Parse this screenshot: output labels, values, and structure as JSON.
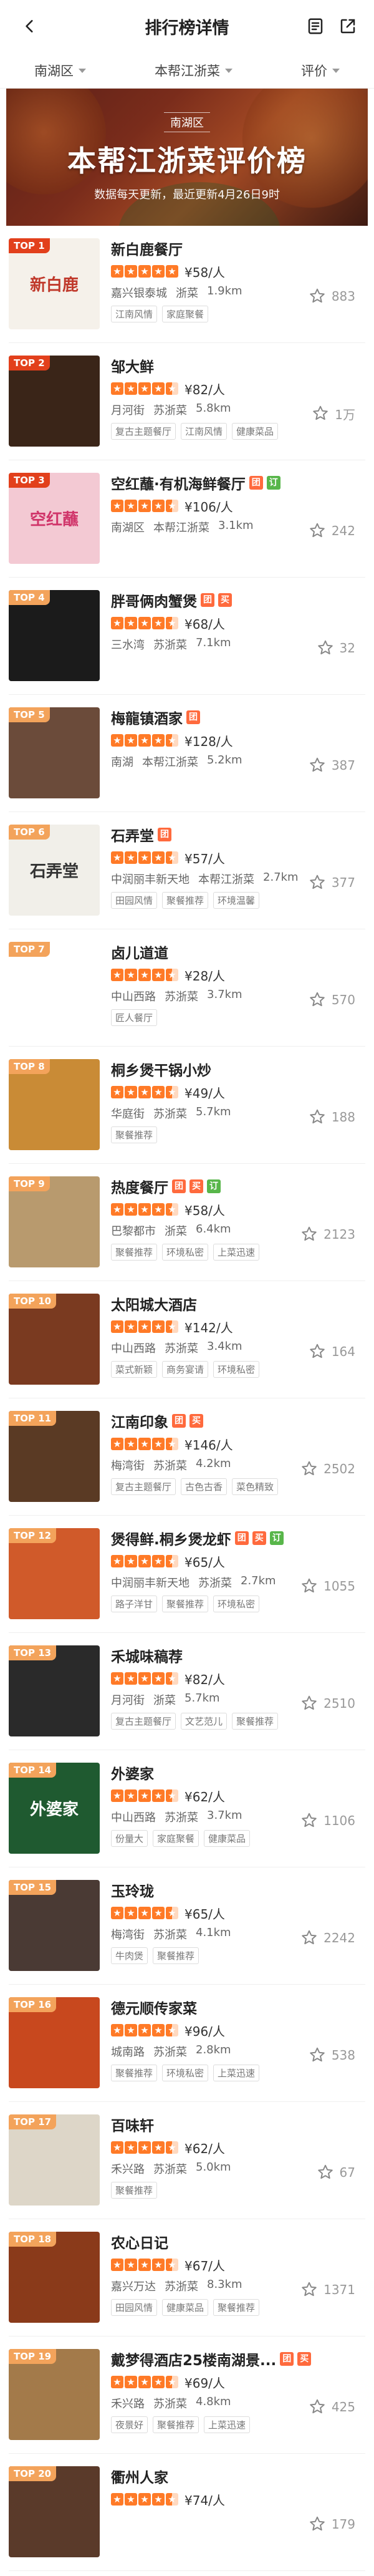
{
  "header": {
    "title": "排行榜详情"
  },
  "filters": [
    {
      "label": "南湖区"
    },
    {
      "label": "本帮江浙菜"
    },
    {
      "label": "评价"
    }
  ],
  "banner": {
    "district": "南湖区",
    "headline": "本帮江浙菜评价榜",
    "sub": "数据每天更新，最近更新4月26日9时"
  },
  "items": [
    {
      "rank": "TOP 1",
      "name": "新白鹿餐厅",
      "tags": [],
      "stars": 5,
      "price": "¥58/人",
      "area": "嘉兴银泰城",
      "cuisine": "浙菜",
      "dist": "1.9km",
      "chips": [
        "江南风情",
        "家庭聚餐"
      ],
      "fav": "883",
      "thumb": "#f5f1ea",
      "thumb_text": "新白鹿",
      "thumb_color": "#c0392b"
    },
    {
      "rank": "TOP 2",
      "name": "邹大鲜",
      "tags": [],
      "stars": 4.5,
      "price": "¥82/人",
      "area": "月河街",
      "cuisine": "苏浙菜",
      "dist": "5.8km",
      "chips": [
        "复古主题餐厅",
        "江南风情",
        "健康菜品"
      ],
      "fav": "1万",
      "thumb": "#3a2518",
      "thumb_text": "",
      "thumb_color": "#fff"
    },
    {
      "rank": "TOP 3",
      "name": "空红蘸·有机海鲜餐厅",
      "tags": [
        "团",
        "订"
      ],
      "stars": 4.5,
      "price": "¥106/人",
      "area": "南湖区",
      "cuisine": "本帮江浙菜",
      "dist": "3.1km",
      "chips": [],
      "fav": "242",
      "thumb": "#f3c9d3",
      "thumb_text": "空红蘸",
      "thumb_color": "#d0356a"
    },
    {
      "rank": "TOP 4",
      "name": "胖哥俩肉蟹煲",
      "tags": [
        "团",
        "买"
      ],
      "stars": 4.5,
      "price": "¥68/人",
      "area": "三水湾",
      "cuisine": "苏浙菜",
      "dist": "7.1km",
      "chips": [],
      "fav": "32",
      "thumb": "#1b1b1b",
      "thumb_text": "",
      "thumb_color": "#fff"
    },
    {
      "rank": "TOP 5",
      "name": "梅龍镇酒家",
      "tags": [
        "团"
      ],
      "stars": 4.5,
      "price": "¥128/人",
      "area": "南湖",
      "cuisine": "本帮江浙菜",
      "dist": "5.2km",
      "chips": [],
      "fav": "387",
      "thumb": "#6b4b3a",
      "thumb_text": "",
      "thumb_color": "#fff"
    },
    {
      "rank": "TOP 6",
      "name": "石弄堂",
      "tags": [
        "团"
      ],
      "stars": 4.5,
      "price": "¥57/人",
      "area": "中润丽丰新天地",
      "cuisine": "本帮江浙菜",
      "dist": "2.7km",
      "chips": [
        "田园风情",
        "聚餐推荐",
        "环境温馨"
      ],
      "fav": "377",
      "thumb": "#f1efe9",
      "thumb_text": "石弄堂",
      "thumb_color": "#333"
    },
    {
      "rank": "TOP 7",
      "name": "卤儿道道",
      "tags": [],
      "stars": 4.5,
      "price": "¥28/人",
      "area": "中山西路",
      "cuisine": "苏浙菜",
      "dist": "3.7km",
      "chips": [
        "匠人餐厅"
      ],
      "fav": "570",
      "thumb": "#ffffff",
      "thumb_text": "",
      "thumb_color": "#1c4c74"
    },
    {
      "rank": "TOP 8",
      "name": "桐乡煲干锅小炒",
      "tags": [],
      "stars": 4.5,
      "price": "¥49/人",
      "area": "华庭街",
      "cuisine": "苏浙菜",
      "dist": "5.7km",
      "chips": [
        "聚餐推荐"
      ],
      "fav": "188",
      "thumb": "#c98b36",
      "thumb_text": "",
      "thumb_color": "#fff"
    },
    {
      "rank": "TOP 9",
      "name": "热度餐厅",
      "tags": [
        "团",
        "买",
        "订"
      ],
      "stars": 4.5,
      "price": "¥58/人",
      "area": "巴黎都市",
      "cuisine": "浙菜",
      "dist": "6.4km",
      "chips": [
        "聚餐推荐",
        "环境私密",
        "上菜迅速"
      ],
      "fav": "2123",
      "thumb": "#b89a6e",
      "thumb_text": "",
      "thumb_color": "#fff"
    },
    {
      "rank": "TOP 10",
      "name": "太阳城大酒店",
      "tags": [],
      "stars": 4.5,
      "price": "¥142/人",
      "area": "中山西路",
      "cuisine": "苏浙菜",
      "dist": "3.4km",
      "chips": [
        "菜式新颖",
        "商务宴请",
        "环境私密"
      ],
      "fav": "164",
      "thumb": "#7a3a20",
      "thumb_text": "",
      "thumb_color": "#fff"
    },
    {
      "rank": "TOP 11",
      "name": "江南印象",
      "tags": [
        "团",
        "买"
      ],
      "stars": 4.5,
      "price": "¥146/人",
      "area": "梅湾街",
      "cuisine": "苏浙菜",
      "dist": "4.2km",
      "chips": [
        "复古主题餐厅",
        "古色古香",
        "菜色精致"
      ],
      "fav": "2502",
      "thumb": "#5a3a24",
      "thumb_text": "",
      "thumb_color": "#fff"
    },
    {
      "rank": "TOP 12",
      "name": "煲得鲜.桐乡煲龙虾",
      "tags": [
        "团",
        "买",
        "订"
      ],
      "stars": 4.5,
      "price": "¥65/人",
      "area": "中润丽丰新天地",
      "cuisine": "苏浙菜",
      "dist": "2.7km",
      "chips": [
        "路子洋甘",
        "聚餐推荐",
        "环境私密"
      ],
      "fav": "1055",
      "thumb": "#d05a2a",
      "thumb_text": "",
      "thumb_color": "#fff"
    },
    {
      "rank": "TOP 13",
      "name": "禾城味稿荐",
      "tags": [],
      "stars": 4.5,
      "price": "¥82/人",
      "area": "月河街",
      "cuisine": "浙菜",
      "dist": "5.7km",
      "chips": [
        "复古主题餐厅",
        "文艺范儿",
        "聚餐推荐"
      ],
      "fav": "2510",
      "thumb": "#2a2a2a",
      "thumb_text": "",
      "thumb_color": "#fff"
    },
    {
      "rank": "TOP 14",
      "name": "外婆家",
      "tags": [],
      "stars": 4.5,
      "price": "¥62/人",
      "area": "中山西路",
      "cuisine": "苏浙菜",
      "dist": "3.7km",
      "chips": [
        "份量大",
        "家庭聚餐",
        "健康菜品"
      ],
      "fav": "1106",
      "thumb": "#1f5a30",
      "thumb_text": "外婆家",
      "thumb_color": "#fff"
    },
    {
      "rank": "TOP 15",
      "name": "玉玲珑",
      "tags": [],
      "stars": 4.5,
      "price": "¥65/人",
      "area": "梅湾街",
      "cuisine": "苏浙菜",
      "dist": "4.1km",
      "chips": [
        "牛肉煲",
        "聚餐推荐"
      ],
      "fav": "2242",
      "thumb": "#4a3a34",
      "thumb_text": "",
      "thumb_color": "#fff"
    },
    {
      "rank": "TOP 16",
      "name": "德元顺传家菜",
      "tags": [],
      "stars": 4.5,
      "price": "¥96/人",
      "area": "城南路",
      "cuisine": "苏浙菜",
      "dist": "2.8km",
      "chips": [
        "聚餐推荐",
        "环境私密",
        "上菜迅速"
      ],
      "fav": "538",
      "thumb": "#c8481e",
      "thumb_text": "",
      "thumb_color": "#fff"
    },
    {
      "rank": "TOP 17",
      "name": "百味轩",
      "tags": [],
      "stars": 4.5,
      "price": "¥62/人",
      "area": "禾兴路",
      "cuisine": "苏浙菜",
      "dist": "5.0km",
      "chips": [
        "聚餐推荐"
      ],
      "fav": "67",
      "thumb": "#ddd6c8",
      "thumb_text": "",
      "thumb_color": "#fff"
    },
    {
      "rank": "TOP 18",
      "name": "农心日记",
      "tags": [],
      "stars": 4.5,
      "price": "¥67/人",
      "area": "嘉兴万达",
      "cuisine": "苏浙菜",
      "dist": "8.3km",
      "chips": [
        "田园风情",
        "健康菜品",
        "聚餐推荐"
      ],
      "fav": "1371",
      "thumb": "#8a3a1a",
      "thumb_text": "",
      "thumb_color": "#fff"
    },
    {
      "rank": "TOP 19",
      "name": "戴梦得酒店25楼南湖景...",
      "tags": [
        "团",
        "买"
      ],
      "stars": 4.5,
      "price": "¥69/人",
      "area": "禾兴路",
      "cuisine": "苏浙菜",
      "dist": "4.8km",
      "chips": [
        "夜景好",
        "聚餐推荐",
        "上菜迅速"
      ],
      "fav": "425",
      "thumb": "#a37a4a",
      "thumb_text": "",
      "thumb_color": "#fff"
    },
    {
      "rank": "TOP 20",
      "name": "衢州人家",
      "tags": [],
      "stars": 4.5,
      "price": "¥74/人",
      "area": "",
      "cuisine": "",
      "dist": "",
      "chips": [],
      "fav": "179",
      "thumb": "#5a3a2a",
      "thumb_text": "",
      "thumb_color": "#fff"
    }
  ]
}
